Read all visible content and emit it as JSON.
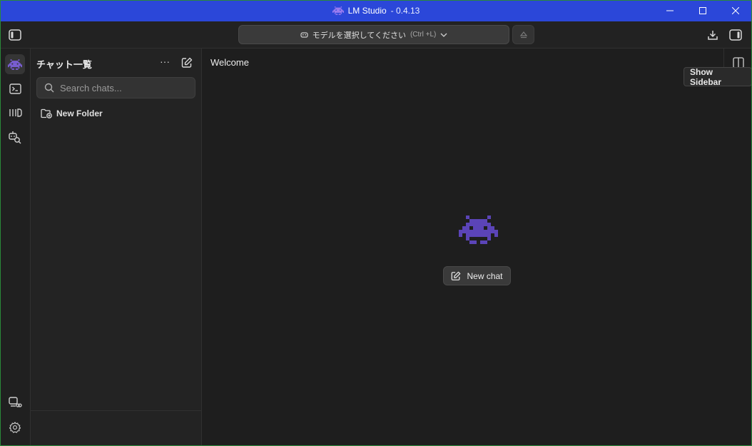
{
  "window": {
    "app_name": "LM Studio",
    "version": "- 0.4.13",
    "controls": [
      "minimize-icon",
      "maximize-icon",
      "close-icon"
    ]
  },
  "toolbar": {
    "model_select_label": "モデルを選択してください",
    "model_select_shortcut": "(Ctrl +L)",
    "icons": [
      "sidebar-left-icon",
      "download-icon",
      "sidebar-right-icon",
      "eject-icon"
    ]
  },
  "rail": {
    "items": [
      "chat-icon",
      "terminal-icon",
      "models-icon",
      "discover-icon"
    ],
    "bottom_items": [
      "server-icon",
      "settings-icon"
    ]
  },
  "chats": {
    "title": "チャット一覧",
    "more_label": "···",
    "search_placeholder": "Search chats...",
    "folders": [
      {
        "label": "New Folder"
      }
    ]
  },
  "main": {
    "title": "Welcome",
    "new_chat_label": "New chat",
    "tooltip": "Show Sidebar"
  },
  "colors": {
    "titlebar": "#2b47d9",
    "brand_purple": "#5b44b8",
    "background": "#1e1e1e"
  }
}
